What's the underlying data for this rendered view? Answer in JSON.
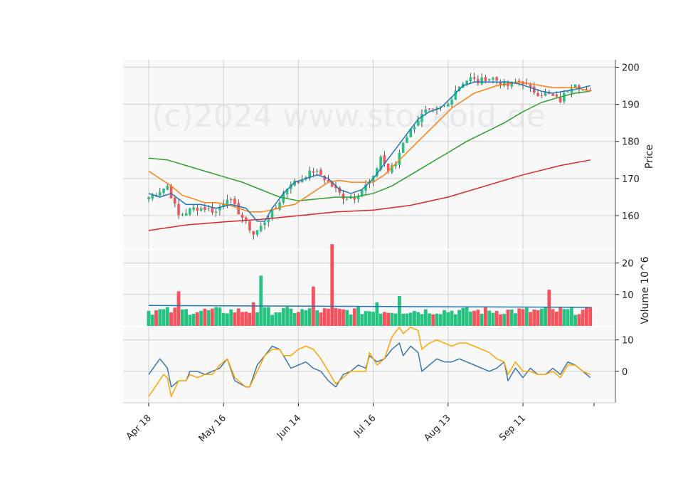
{
  "colors": {
    "panel_bg": "#f8f8f8",
    "grid": "#cfcfcf",
    "up": "#26c281",
    "down": "#f4535d",
    "wick": "#333333",
    "ma_fast": "#1f77b4",
    "ma_mid": "#ff7f0e",
    "ma_slow": "#2ca02c",
    "ma_long": "#d62728",
    "vol_avg": "#1f77b4",
    "osc1": "#3a78b0",
    "osc2": "#ffa500",
    "watermark": "#d9d9d9"
  },
  "watermark": "(c)2024 www.stockoid.de",
  "chart_data": {
    "type": "candlestick",
    "x_ticks": [
      "Apr 18",
      "May 16",
      "Jun 14",
      "Jul 16",
      "Aug 13",
      "Sep 11"
    ],
    "x_tick_index": [
      0,
      20,
      40,
      60,
      80,
      100
    ],
    "n_bars": 119,
    "price_panel": {
      "ylabel": "Price",
      "ylim": [
        151,
        202
      ],
      "yticks": [
        160,
        170,
        180,
        190,
        200
      ],
      "anchors": [
        [
          0,
          165
        ],
        [
          5,
          168
        ],
        [
          8,
          160
        ],
        [
          12,
          162
        ],
        [
          15,
          162
        ],
        [
          18,
          161
        ],
        [
          21,
          165
        ],
        [
          24,
          161
        ],
        [
          26,
          158
        ],
        [
          28,
          155
        ],
        [
          30,
          157
        ],
        [
          32,
          160
        ],
        [
          34,
          162
        ],
        [
          36,
          166
        ],
        [
          38,
          169
        ],
        [
          40,
          169
        ],
        [
          42,
          171
        ],
        [
          44,
          172
        ],
        [
          46,
          171
        ],
        [
          48,
          169
        ],
        [
          50,
          167
        ],
        [
          52,
          165
        ],
        [
          55,
          165
        ],
        [
          58,
          168
        ],
        [
          60,
          170
        ],
        [
          62,
          176
        ],
        [
          64,
          172
        ],
        [
          66,
          174
        ],
        [
          68,
          180
        ],
        [
          70,
          183
        ],
        [
          72,
          186
        ],
        [
          74,
          188
        ],
        [
          76,
          188
        ],
        [
          78,
          189
        ],
        [
          80,
          190
        ],
        [
          82,
          194
        ],
        [
          84,
          196
        ],
        [
          86,
          197
        ],
        [
          88,
          196
        ],
        [
          90,
          197
        ],
        [
          92,
          197
        ],
        [
          94,
          196
        ],
        [
          96,
          195
        ],
        [
          98,
          196
        ],
        [
          100,
          196
        ],
        [
          102,
          194
        ],
        [
          104,
          193
        ],
        [
          106,
          193
        ],
        [
          108,
          192
        ],
        [
          110,
          191
        ],
        [
          112,
          194
        ],
        [
          114,
          196
        ],
        [
          116,
          194
        ],
        [
          118,
          193
        ]
      ],
      "ma_fast": [
        [
          0,
          166
        ],
        [
          3,
          165
        ],
        [
          6,
          166
        ],
        [
          10,
          163
        ],
        [
          14,
          163
        ],
        [
          18,
          162
        ],
        [
          22,
          163
        ],
        [
          26,
          162
        ],
        [
          29,
          158.5
        ],
        [
          31,
          158.5
        ],
        [
          33,
          162
        ],
        [
          36,
          166
        ],
        [
          39,
          169
        ],
        [
          42,
          170
        ],
        [
          45,
          171
        ],
        [
          48,
          170
        ],
        [
          51,
          167
        ],
        [
          54,
          166
        ],
        [
          57,
          167
        ],
        [
          60,
          170
        ],
        [
          63,
          174
        ],
        [
          66,
          178
        ],
        [
          69,
          182
        ],
        [
          72,
          186
        ],
        [
          75,
          188
        ],
        [
          78,
          189
        ],
        [
          81,
          192
        ],
        [
          84,
          195
        ],
        [
          87,
          196
        ],
        [
          90,
          196
        ],
        [
          93,
          196
        ],
        [
          96,
          196
        ],
        [
          99,
          195.5
        ],
        [
          102,
          194.5
        ],
        [
          105,
          193.5
        ],
        [
          108,
          193
        ],
        [
          111,
          193.5
        ],
        [
          114,
          194
        ],
        [
          116,
          194.5
        ],
        [
          118,
          195
        ]
      ],
      "ma_mid": [
        [
          0,
          172
        ],
        [
          3,
          170
        ],
        [
          6,
          168
        ],
        [
          9,
          165.5
        ],
        [
          12,
          164.5
        ],
        [
          15,
          163.5
        ],
        [
          18,
          163.5
        ],
        [
          21,
          163
        ],
        [
          24,
          162
        ],
        [
          27,
          161
        ],
        [
          30,
          161
        ],
        [
          33,
          161.5
        ],
        [
          36,
          162.5
        ],
        [
          39,
          163
        ],
        [
          42,
          165
        ],
        [
          45,
          167
        ],
        [
          48,
          169
        ],
        [
          51,
          169.5
        ],
        [
          54,
          169
        ],
        [
          57,
          169
        ],
        [
          60,
          169
        ],
        [
          63,
          171
        ],
        [
          66,
          174
        ],
        [
          69,
          177
        ],
        [
          72,
          180
        ],
        [
          75,
          183
        ],
        [
          78,
          186
        ],
        [
          81,
          189
        ],
        [
          84,
          191
        ],
        [
          87,
          193
        ],
        [
          90,
          194
        ],
        [
          93,
          195
        ],
        [
          96,
          195.5
        ],
        [
          99,
          196
        ],
        [
          102,
          195.5
        ],
        [
          105,
          195
        ],
        [
          108,
          194.5
        ],
        [
          111,
          194.5
        ],
        [
          114,
          194.5
        ],
        [
          116,
          194
        ],
        [
          118,
          193.5
        ]
      ],
      "ma_slow": [
        [
          0,
          175.5
        ],
        [
          5,
          175
        ],
        [
          10,
          173.5
        ],
        [
          15,
          172
        ],
        [
          20,
          170.5
        ],
        [
          25,
          169
        ],
        [
          30,
          167
        ],
        [
          35,
          165
        ],
        [
          40,
          164
        ],
        [
          45,
          164.5
        ],
        [
          50,
          165
        ],
        [
          55,
          165
        ],
        [
          60,
          166
        ],
        [
          65,
          168
        ],
        [
          70,
          171
        ],
        [
          75,
          174
        ],
        [
          80,
          177
        ],
        [
          85,
          180
        ],
        [
          90,
          182.5
        ],
        [
          95,
          185
        ],
        [
          100,
          188
        ],
        [
          105,
          190.5
        ],
        [
          110,
          192
        ],
        [
          114,
          193
        ],
        [
          118,
          193.5
        ]
      ],
      "ma_long": [
        [
          0,
          156
        ],
        [
          10,
          157.5
        ],
        [
          20,
          158.3
        ],
        [
          30,
          159
        ],
        [
          40,
          160
        ],
        [
          50,
          161
        ],
        [
          60,
          161.5
        ],
        [
          70,
          162.8
        ],
        [
          80,
          165
        ],
        [
          90,
          168
        ],
        [
          100,
          171
        ],
        [
          110,
          173.5
        ],
        [
          118,
          175
        ]
      ]
    },
    "volume_panel": {
      "ylabel": "Volume  10^6",
      "ylim": [
        0,
        24
      ],
      "yticks": [
        10,
        20
      ],
      "bars": [
        [
          8,
          11
        ],
        [
          30,
          16
        ],
        [
          44,
          12.5
        ],
        [
          49,
          26
        ],
        [
          67,
          9.5
        ],
        [
          107,
          11.5
        ],
        [
          61,
          7.5
        ],
        [
          28,
          7.5
        ]
      ],
      "base_volume": 5,
      "avg": 6.5
    },
    "oscillator_panel": {
      "ylim": [
        -10,
        14
      ],
      "yticks": [
        0,
        10
      ],
      "line1": [
        [
          0,
          -1
        ],
        [
          3,
          4
        ],
        [
          5,
          1
        ],
        [
          6,
          -5
        ],
        [
          8,
          -3
        ],
        [
          10,
          -3
        ],
        [
          11,
          0
        ],
        [
          13,
          0
        ],
        [
          15,
          -1
        ],
        [
          17,
          0
        ],
        [
          19,
          1
        ],
        [
          21,
          4
        ],
        [
          23,
          -3
        ],
        [
          26,
          -5
        ],
        [
          27,
          -5
        ],
        [
          29,
          2
        ],
        [
          31,
          5
        ],
        [
          33,
          8
        ],
        [
          35,
          7
        ],
        [
          36,
          5
        ],
        [
          38,
          1
        ],
        [
          40,
          2
        ],
        [
          42,
          3
        ],
        [
          44,
          1
        ],
        [
          46,
          0
        ],
        [
          48,
          -3
        ],
        [
          50,
          -5
        ],
        [
          52,
          -1
        ],
        [
          54,
          0
        ],
        [
          56,
          2
        ],
        [
          58,
          1
        ],
        [
          59,
          5
        ],
        [
          61,
          3
        ],
        [
          63,
          4
        ],
        [
          65,
          7
        ],
        [
          67,
          9
        ],
        [
          68,
          5
        ],
        [
          70,
          8
        ],
        [
          72,
          6
        ],
        [
          73,
          0
        ],
        [
          75,
          2
        ],
        [
          77,
          4
        ],
        [
          79,
          3
        ],
        [
          81,
          3
        ],
        [
          83,
          4
        ],
        [
          85,
          3
        ],
        [
          87,
          2
        ],
        [
          89,
          1
        ],
        [
          91,
          0
        ],
        [
          93,
          1
        ],
        [
          95,
          3
        ],
        [
          96,
          -3
        ],
        [
          98,
          1
        ],
        [
          100,
          -2
        ],
        [
          102,
          1
        ],
        [
          104,
          -1
        ],
        [
          106,
          -1
        ],
        [
          108,
          1
        ],
        [
          110,
          -1
        ],
        [
          112,
          3
        ],
        [
          114,
          2
        ],
        [
          116,
          0
        ],
        [
          118,
          -2
        ]
      ],
      "line2": [
        [
          0,
          -8
        ],
        [
          4,
          -1
        ],
        [
          5,
          -2
        ],
        [
          6,
          -8
        ],
        [
          8,
          -3
        ],
        [
          10,
          -3
        ],
        [
          11,
          -1
        ],
        [
          13,
          -2
        ],
        [
          15,
          -1
        ],
        [
          17,
          -1
        ],
        [
          19,
          2
        ],
        [
          21,
          4
        ],
        [
          23,
          -2
        ],
        [
          26,
          -5
        ],
        [
          27,
          -5
        ],
        [
          29,
          0
        ],
        [
          31,
          5
        ],
        [
          33,
          7
        ],
        [
          35,
          7
        ],
        [
          36,
          5
        ],
        [
          38,
          5
        ],
        [
          40,
          7
        ],
        [
          42,
          8
        ],
        [
          44,
          7
        ],
        [
          46,
          4
        ],
        [
          48,
          0
        ],
        [
          50,
          -4
        ],
        [
          52,
          -2
        ],
        [
          54,
          0
        ],
        [
          56,
          0
        ],
        [
          58,
          0
        ],
        [
          59,
          6
        ],
        [
          61,
          2
        ],
        [
          63,
          4
        ],
        [
          65,
          11
        ],
        [
          67,
          14
        ],
        [
          68,
          12
        ],
        [
          70,
          14
        ],
        [
          72,
          13
        ],
        [
          73,
          7
        ],
        [
          75,
          9
        ],
        [
          77,
          10
        ],
        [
          79,
          9
        ],
        [
          81,
          8
        ],
        [
          83,
          9
        ],
        [
          85,
          9
        ],
        [
          87,
          8
        ],
        [
          89,
          7
        ],
        [
          91,
          6
        ],
        [
          93,
          4
        ],
        [
          95,
          3
        ],
        [
          96,
          -1
        ],
        [
          98,
          3
        ],
        [
          100,
          0
        ],
        [
          102,
          0
        ],
        [
          104,
          -1
        ],
        [
          106,
          -1
        ],
        [
          108,
          0
        ],
        [
          110,
          -2
        ],
        [
          112,
          2
        ],
        [
          114,
          2
        ],
        [
          116,
          0
        ],
        [
          118,
          -1
        ]
      ]
    }
  }
}
